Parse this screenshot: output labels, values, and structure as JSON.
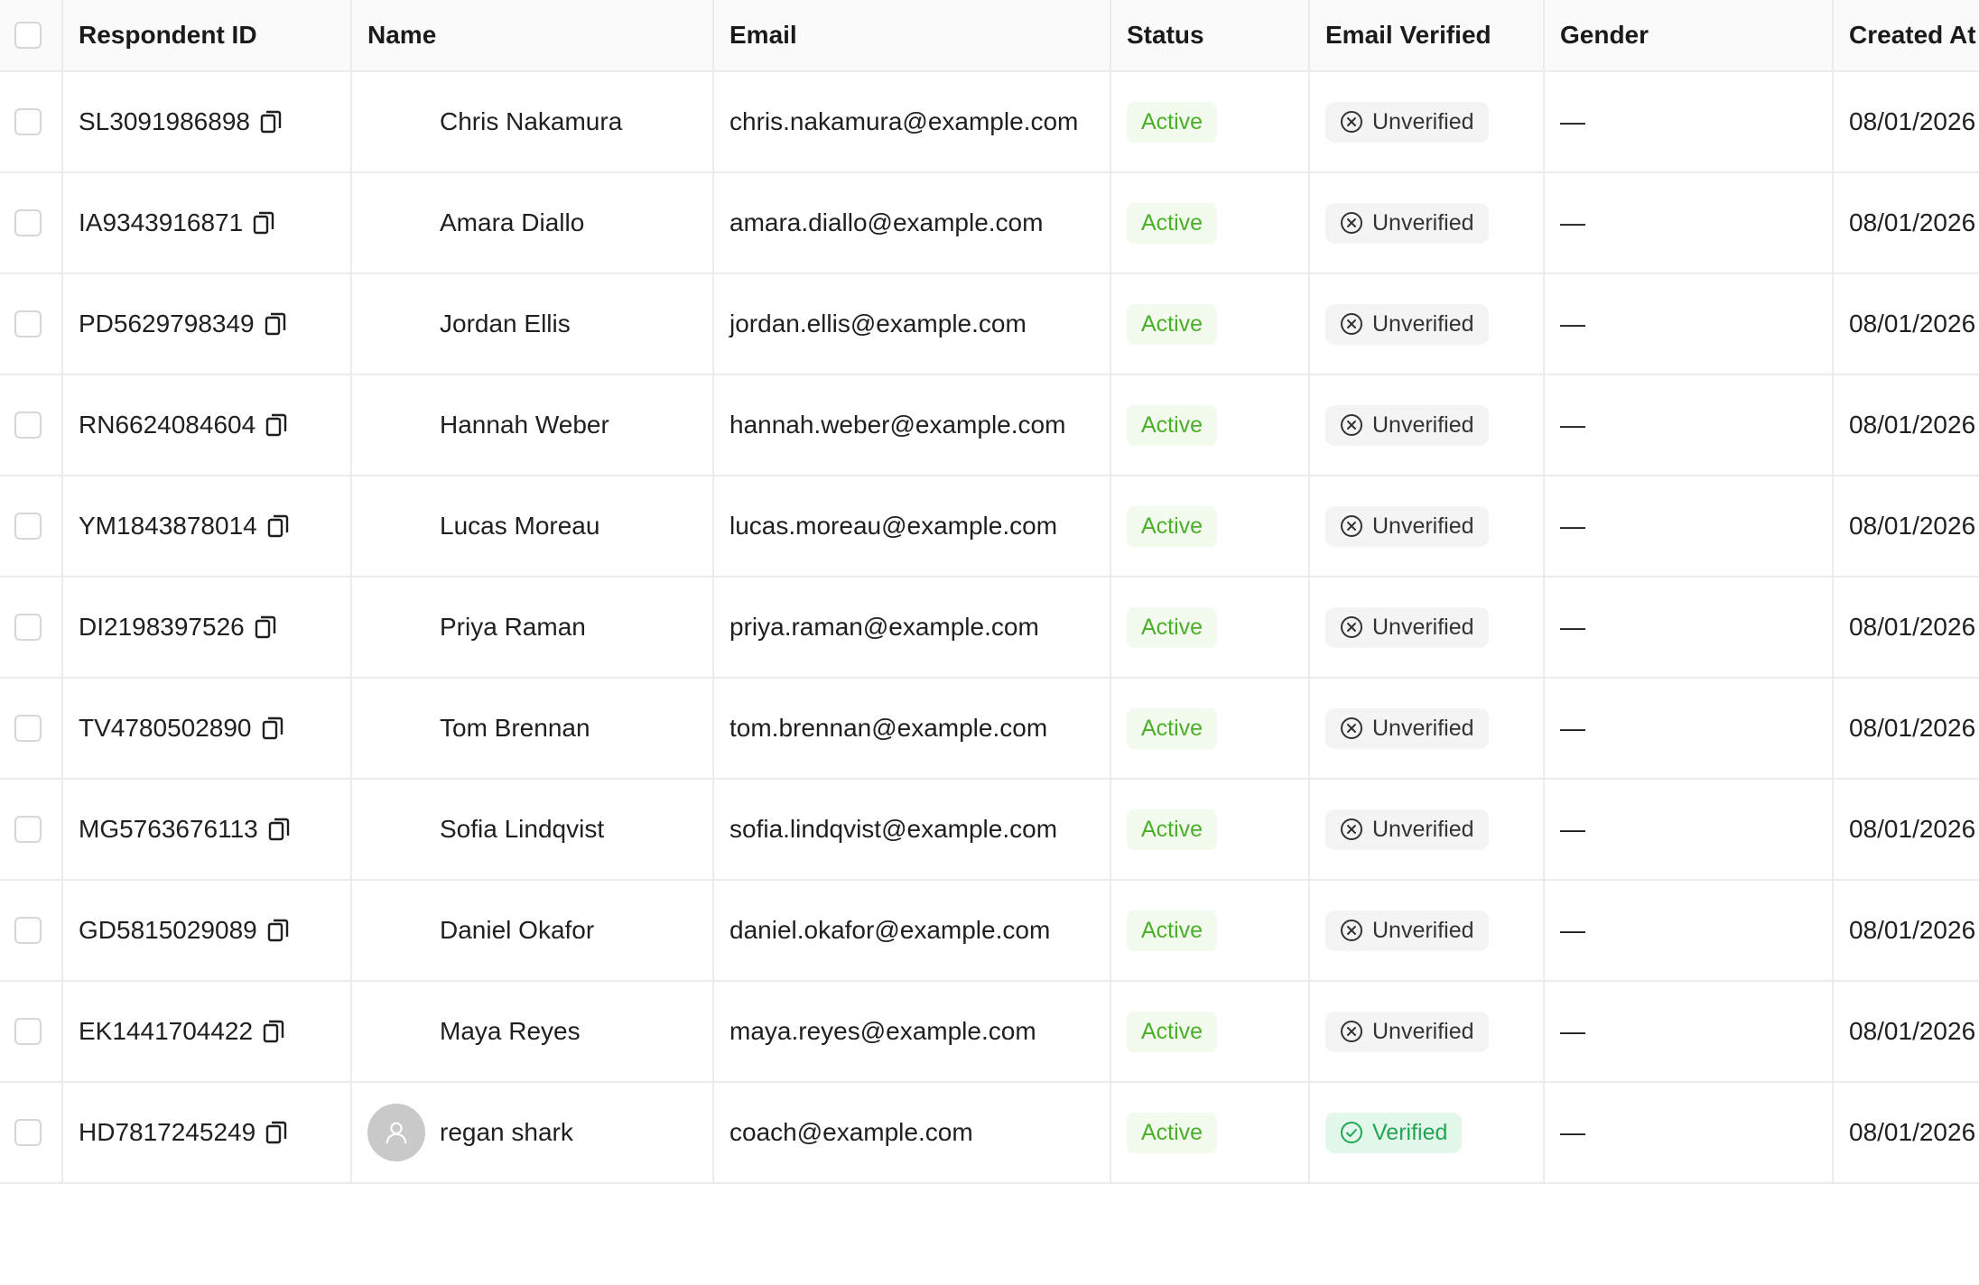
{
  "columns": {
    "respondent_id": "Respondent ID",
    "name": "Name",
    "email": "Email",
    "status": "Status",
    "email_verified": "Email Verified",
    "gender": "Gender",
    "created_at": "Created At"
  },
  "icons": {
    "copy": "copy-icon",
    "unverified": "circle-x-icon",
    "verified": "circle-check-icon",
    "avatar": "user-avatar-icon"
  },
  "colors": {
    "active_text": "#4caf2a",
    "active_bg": "#f3fbee",
    "verified_text": "#20a653",
    "verified_bg": "#e3f8ea",
    "unverified_bg": "#f4f4f4"
  },
  "rows": [
    {
      "id": "SL3091986898",
      "name": "Chris Nakamura",
      "email": "chris.nakamura@example.com",
      "status": "Active",
      "verified": "Unverified",
      "is_verified": false,
      "has_avatar": false,
      "gender": "—",
      "created": "08/01/2026"
    },
    {
      "id": "IA9343916871",
      "name": "Amara Diallo",
      "email": "amara.diallo@example.com",
      "status": "Active",
      "verified": "Unverified",
      "is_verified": false,
      "has_avatar": false,
      "gender": "—",
      "created": "08/01/2026"
    },
    {
      "id": "PD5629798349",
      "name": "Jordan Ellis",
      "email": "jordan.ellis@example.com",
      "status": "Active",
      "verified": "Unverified",
      "is_verified": false,
      "has_avatar": false,
      "gender": "—",
      "created": "08/01/2026"
    },
    {
      "id": "RN6624084604",
      "name": "Hannah Weber",
      "email": "hannah.weber@example.com",
      "status": "Active",
      "verified": "Unverified",
      "is_verified": false,
      "has_avatar": false,
      "gender": "—",
      "created": "08/01/2026"
    },
    {
      "id": "YM1843878014",
      "name": "Lucas Moreau",
      "email": "lucas.moreau@example.com",
      "status": "Active",
      "verified": "Unverified",
      "is_verified": false,
      "has_avatar": false,
      "gender": "—",
      "created": "08/01/2026"
    },
    {
      "id": "DI2198397526",
      "name": "Priya Raman",
      "email": "priya.raman@example.com",
      "status": "Active",
      "verified": "Unverified",
      "is_verified": false,
      "has_avatar": false,
      "gender": "—",
      "created": "08/01/2026"
    },
    {
      "id": "TV4780502890",
      "name": "Tom Brennan",
      "email": "tom.brennan@example.com",
      "status": "Active",
      "verified": "Unverified",
      "is_verified": false,
      "has_avatar": false,
      "gender": "—",
      "created": "08/01/2026"
    },
    {
      "id": "MG5763676113",
      "name": "Sofia Lindqvist",
      "email": "sofia.lindqvist@example.com",
      "status": "Active",
      "verified": "Unverified",
      "is_verified": false,
      "has_avatar": false,
      "gender": "—",
      "created": "08/01/2026"
    },
    {
      "id": "GD5815029089",
      "name": "Daniel Okafor",
      "email": "daniel.okafor@example.com",
      "status": "Active",
      "verified": "Unverified",
      "is_verified": false,
      "has_avatar": false,
      "gender": "—",
      "created": "08/01/2026"
    },
    {
      "id": "EK1441704422",
      "name": "Maya Reyes",
      "email": "maya.reyes@example.com",
      "status": "Active",
      "verified": "Unverified",
      "is_verified": false,
      "has_avatar": false,
      "gender": "—",
      "created": "08/01/2026"
    },
    {
      "id": "HD7817245249",
      "name": "regan shark",
      "email": "coach@example.com",
      "status": "Active",
      "verified": "Verified",
      "is_verified": true,
      "has_avatar": true,
      "gender": "—",
      "created": "08/01/2026"
    }
  ]
}
